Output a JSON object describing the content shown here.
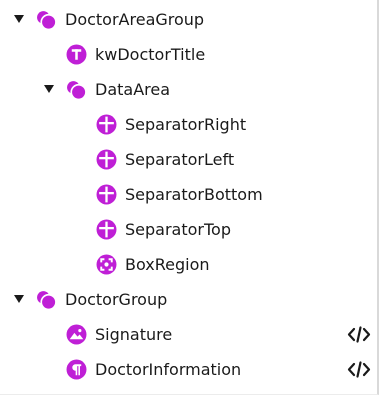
{
  "tree": {
    "items": [
      {
        "label": "DoctorAreaGroup",
        "icon": "group-icon",
        "expanded": true,
        "has_code": false
      },
      {
        "label": "kwDoctorTitle",
        "icon": "text-icon",
        "has_code": false
      },
      {
        "label": "DataArea",
        "icon": "group-icon",
        "expanded": true,
        "has_code": false
      },
      {
        "label": "SeparatorRight",
        "icon": "separator-icon",
        "has_code": false
      },
      {
        "label": "SeparatorLeft",
        "icon": "separator-icon",
        "has_code": false
      },
      {
        "label": "SeparatorBottom",
        "icon": "separator-icon",
        "has_code": false
      },
      {
        "label": "SeparatorTop",
        "icon": "separator-icon",
        "has_code": false
      },
      {
        "label": "BoxRegion",
        "icon": "box-region-icon",
        "has_code": false
      },
      {
        "label": "DoctorGroup",
        "icon": "group-icon",
        "expanded": true,
        "has_code": false
      },
      {
        "label": "Signature",
        "icon": "image-icon",
        "has_code": true
      },
      {
        "label": "DoctorInformation",
        "icon": "paragraph-icon",
        "has_code": true
      }
    ]
  },
  "colors": {
    "icon": "#bf1fd6",
    "text": "#1a1a1a",
    "caret": "#1a1a1a"
  }
}
